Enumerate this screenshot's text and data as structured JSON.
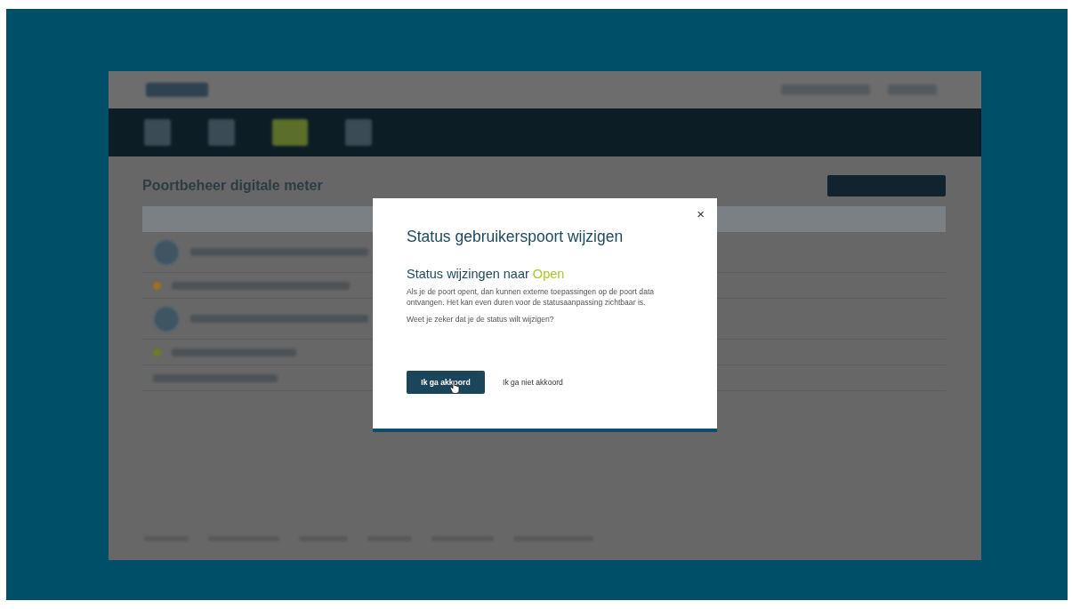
{
  "background_page": {
    "title": "Poortbeheer digitale meter"
  },
  "dialog": {
    "close": "×",
    "title": "Status gebruikerspoort wijzigen",
    "subtitle": "Status wijzingen naar",
    "status": "Open",
    "body": "Als je de poort opent, dan kunnen externe toepassingen op de poort data ontvangen. Het kan even duren voor de statusaanpassing zichtbaar is.",
    "question": "Weet je zeker dat je de status wilt wijzigen?",
    "buttons": [
      {
        "label": "Ik ga akkoord",
        "kind": "primary"
      },
      {
        "label": "Ik ga niet akkoord",
        "kind": "secondary"
      }
    ]
  }
}
